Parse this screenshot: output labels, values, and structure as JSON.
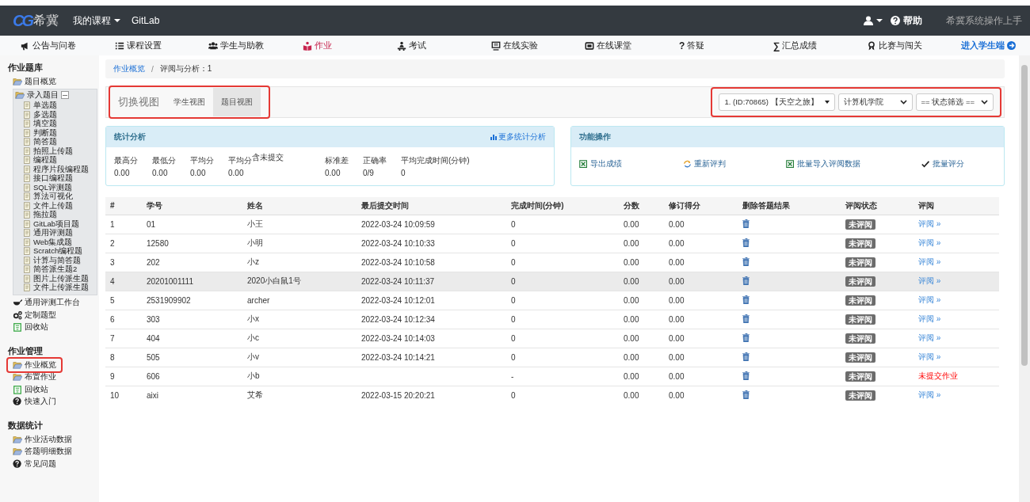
{
  "header": {
    "logo_mark": "CG",
    "logo_text": "希冀",
    "menu": "我的课程",
    "link": "GitLab",
    "help": "帮助",
    "guide": "希冀系统操作上手"
  },
  "nav": {
    "items": [
      {
        "label": "公告与问卷",
        "selected": false
      },
      {
        "label": "课程设置",
        "selected": false
      },
      {
        "label": "学生与助教",
        "selected": false
      },
      {
        "label": "作业",
        "selected": true
      },
      {
        "label": "考试",
        "selected": false
      },
      {
        "label": "在线实验",
        "selected": false
      },
      {
        "label": "在线课堂",
        "selected": false
      },
      {
        "label": "答疑",
        "glyph": "?",
        "selected": false
      },
      {
        "label": "汇总成绩",
        "glyph": "∑",
        "selected": false
      },
      {
        "label": "比赛与闯关",
        "selected": false
      }
    ],
    "student_link": "进入学生端"
  },
  "sidebar": {
    "sections": [
      {
        "title": "作业题库",
        "items": [
          {
            "label": "题目概览",
            "kind": "folder",
            "highlighted": false
          },
          {
            "label": "录入题目",
            "kind": "folder",
            "highlighted": false,
            "expanded": true,
            "children": [
              {
                "label": "单选题"
              },
              {
                "label": "多选题"
              },
              {
                "label": "填空题"
              },
              {
                "label": "判断题"
              },
              {
                "label": "简答题"
              },
              {
                "label": "拍照上传题"
              },
              {
                "label": "编程题"
              },
              {
                "label": "程序片段编程题"
              },
              {
                "label": "接口编程题"
              },
              {
                "label": "SQL评测题"
              },
              {
                "label": "算法可视化"
              },
              {
                "label": "文件上传题"
              },
              {
                "label": "拖拉题"
              },
              {
                "label": "GitLab项目题"
              },
              {
                "label": "通用评测题"
              },
              {
                "label": "Web集成题"
              },
              {
                "label": "Scratch编程题"
              },
              {
                "label": "计算与简答题"
              },
              {
                "label": "简答派生题2"
              },
              {
                "label": "图片上传派生题"
              },
              {
                "label": "文件上传派生题"
              }
            ]
          },
          {
            "label": "通用评测工作台",
            "kind": "tool",
            "highlighted": false
          },
          {
            "label": "定制题型",
            "kind": "gears",
            "highlighted": false
          },
          {
            "label": "回收站",
            "kind": "bin",
            "highlighted": false
          }
        ]
      },
      {
        "title": "作业管理",
        "items": [
          {
            "label": "作业概览",
            "kind": "folder",
            "highlighted": true
          },
          {
            "label": "布置作业",
            "kind": "folder",
            "highlighted": false
          },
          {
            "label": "回收站",
            "kind": "bin",
            "highlighted": false
          },
          {
            "label": "快速入门",
            "kind": "help",
            "highlighted": false
          }
        ]
      },
      {
        "title": "数据统计",
        "items": [
          {
            "label": "作业活动数据",
            "kind": "folder",
            "highlighted": false
          },
          {
            "label": "答题明细数据",
            "kind": "folder",
            "highlighted": false
          },
          {
            "label": "常见问题",
            "kind": "help",
            "highlighted": false
          }
        ]
      }
    ]
  },
  "breadcrumb": {
    "items": [
      "作业概览",
      "评阅与分析：1"
    ],
    "separator": "/"
  },
  "view_switch": {
    "title": "切换视图",
    "highlighted": true,
    "options": [
      {
        "label": "学生视图",
        "selected": false
      },
      {
        "label": "题目视图",
        "selected": true
      }
    ]
  },
  "filters": {
    "highlighted": true,
    "items": [
      {
        "value": "1. (ID:70865) 【天空之旅】",
        "kind": "menu"
      },
      {
        "value": "计算机学院",
        "kind": "select"
      },
      {
        "value": "== 状态筛选 ==",
        "kind": "select"
      }
    ]
  },
  "stats": {
    "title": "统计分析",
    "link": "更多统计分析",
    "cells": [
      {
        "label": "最高分",
        "value": "0.00"
      },
      {
        "label": "最低分",
        "value": "0.00"
      },
      {
        "label": "平均分",
        "value": "0.00"
      },
      {
        "label": "平均分$^{含未提交}$",
        "value": "0.00"
      },
      {
        "label": "标准差",
        "value": "0.00"
      },
      {
        "label": "正确率",
        "value": "0/9"
      },
      {
        "label": "平均完成时间(分钟)",
        "value": "0"
      }
    ]
  },
  "actions": {
    "title": "功能操作",
    "items": [
      {
        "label": "导出成绩",
        "kind": "excel"
      },
      {
        "label": "重新评判",
        "kind": "refresh"
      },
      {
        "label": "批量导入评阅数据",
        "kind": "excel"
      },
      {
        "label": "批量评分",
        "kind": "check"
      }
    ]
  },
  "table": {
    "columns": [
      "#",
      "学号",
      "姓名",
      "最后提交时间",
      "完成时间(分钟)",
      "分数",
      "修订得分",
      "删除答题结果",
      "评阅状态",
      "评阅"
    ],
    "rows": [
      {
        "cells": [
          "1",
          "01",
          "小王",
          "2022-03-24 10:09:59",
          "0",
          "0.00",
          "0.00"
        ],
        "status": "未评阅",
        "review": {
          "text": "评阅 »",
          "kind": "link"
        },
        "highlighted": false
      },
      {
        "cells": [
          "2",
          "12580",
          "小明",
          "2022-03-24 10:10:33",
          "0",
          "0.00",
          "0.00"
        ],
        "status": "未评阅",
        "review": {
          "text": "评阅 »",
          "kind": "link"
        },
        "highlighted": false
      },
      {
        "cells": [
          "3",
          "202",
          "小z",
          "2022-03-24 10:10:58",
          "0",
          "0.00",
          "0.00"
        ],
        "status": "未评阅",
        "review": {
          "text": "评阅 »",
          "kind": "link"
        },
        "highlighted": false
      },
      {
        "cells": [
          "4",
          "20201001111",
          "2020小白鼠1号",
          "2022-03-24 10:11:37",
          "0",
          "0.00",
          "0.00"
        ],
        "status": "未评阅",
        "review": {
          "text": "评阅 »",
          "kind": "link"
        },
        "highlighted": true
      },
      {
        "cells": [
          "5",
          "2531909902",
          "archer",
          "2022-03-24 10:12:01",
          "0",
          "0.00",
          "0.00"
        ],
        "status": "未评阅",
        "review": {
          "text": "评阅 »",
          "kind": "link"
        },
        "highlighted": false
      },
      {
        "cells": [
          "6",
          "303",
          "小x",
          "2022-03-24 10:12:34",
          "0",
          "0.00",
          "0.00"
        ],
        "status": "未评阅",
        "review": {
          "text": "评阅 »",
          "kind": "link"
        },
        "highlighted": false
      },
      {
        "cells": [
          "7",
          "404",
          "小c",
          "2022-03-24 10:14:03",
          "0",
          "0.00",
          "0.00"
        ],
        "status": "未评阅",
        "review": {
          "text": "评阅 »",
          "kind": "link"
        },
        "highlighted": false
      },
      {
        "cells": [
          "8",
          "505",
          "小v",
          "2022-03-24 10:14:21",
          "0",
          "0.00",
          "0.00"
        ],
        "status": "未评阅",
        "review": {
          "text": "评阅 »",
          "kind": "link"
        },
        "highlighted": false
      },
      {
        "cells": [
          "9",
          "606",
          "小b",
          "",
          "-",
          "0.00",
          "0.00"
        ],
        "status": "未评阅",
        "review": {
          "text": "未提交作业",
          "kind": "warning"
        },
        "highlighted": false
      },
      {
        "cells": [
          "10",
          "aixi",
          "艾希",
          "2022-03-15 20:20:21",
          "0",
          "0.00",
          "0.00"
        ],
        "status": "未评阅",
        "review": {
          "text": "评阅 »",
          "kind": "link"
        },
        "highlighted": false
      }
    ]
  }
}
